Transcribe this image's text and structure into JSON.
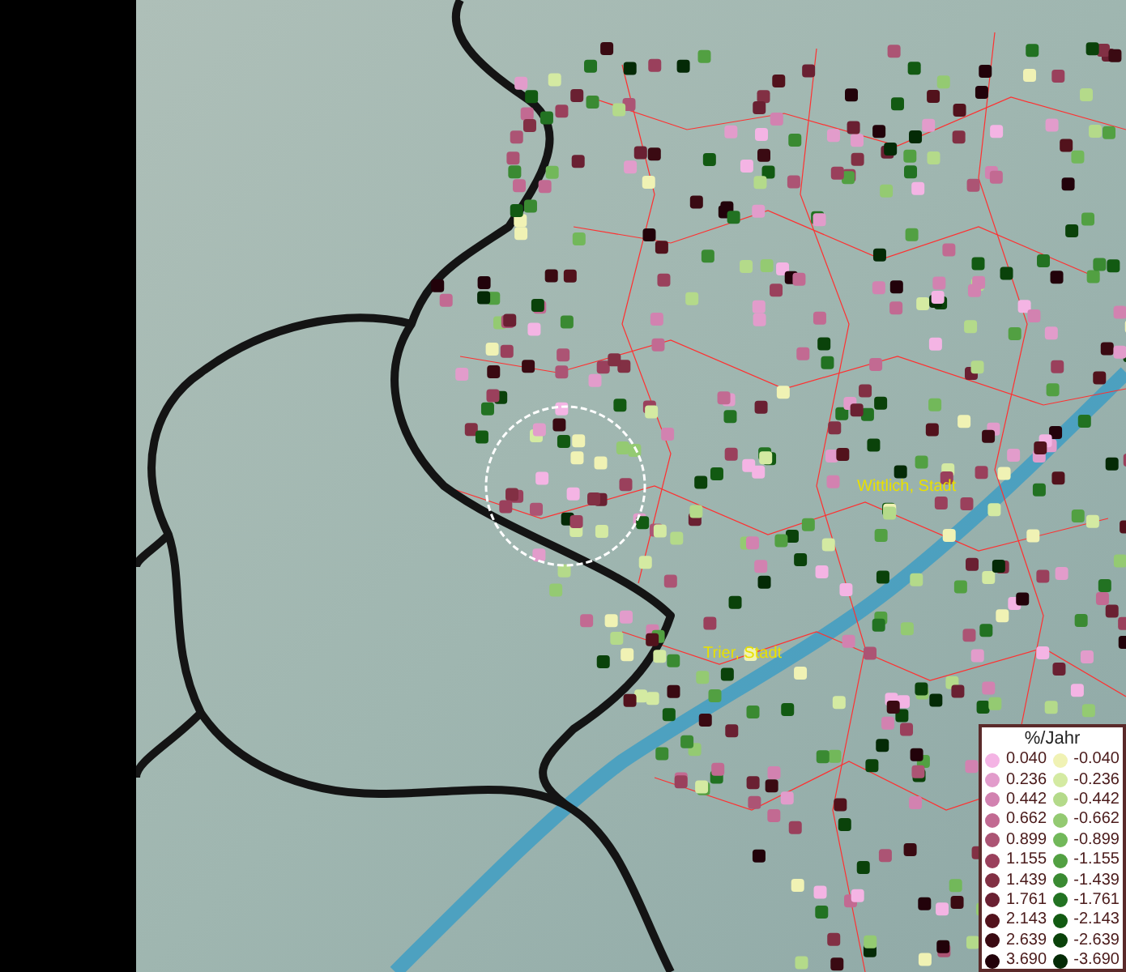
{
  "map": {
    "places": [
      {
        "name": "Wittlich, Stadt"
      },
      {
        "name": "Trier, Stadt"
      }
    ]
  },
  "legend": {
    "title": "%/Jahr",
    "positive": [
      {
        "value": "0.040",
        "color": "#f4b4e4"
      },
      {
        "value": "0.236",
        "color": "#e29ccb"
      },
      {
        "value": "0.442",
        "color": "#d282b0"
      },
      {
        "value": "0.662",
        "color": "#c26a92"
      },
      {
        "value": "0.899",
        "color": "#ac5474"
      },
      {
        "value": "1.155",
        "color": "#9a405c"
      },
      {
        "value": "1.439",
        "color": "#823044"
      },
      {
        "value": "1.761",
        "color": "#6a2032"
      },
      {
        "value": "2.143",
        "color": "#52121c"
      },
      {
        "value": "2.639",
        "color": "#3a0a12"
      },
      {
        "value": "3.690",
        "color": "#22020a"
      }
    ],
    "negative": [
      {
        "value": "-0.040",
        "color": "#f0f2b4"
      },
      {
        "value": "-0.236",
        "color": "#d4eaa2"
      },
      {
        "value": "-0.442",
        "color": "#b4da8a"
      },
      {
        "value": "-0.662",
        "color": "#94ca72"
      },
      {
        "value": "-0.899",
        "color": "#72b85a"
      },
      {
        "value": "-1.155",
        "color": "#52a042"
      },
      {
        "value": "-1.439",
        "color": "#3a8a32"
      },
      {
        "value": "-1.761",
        "color": "#227222"
      },
      {
        "value": "-2.143",
        "color": "#125a12"
      },
      {
        "value": "-2.639",
        "color": "#0a420a"
      },
      {
        "value": "-3.690",
        "color": "#042a06"
      }
    ]
  }
}
